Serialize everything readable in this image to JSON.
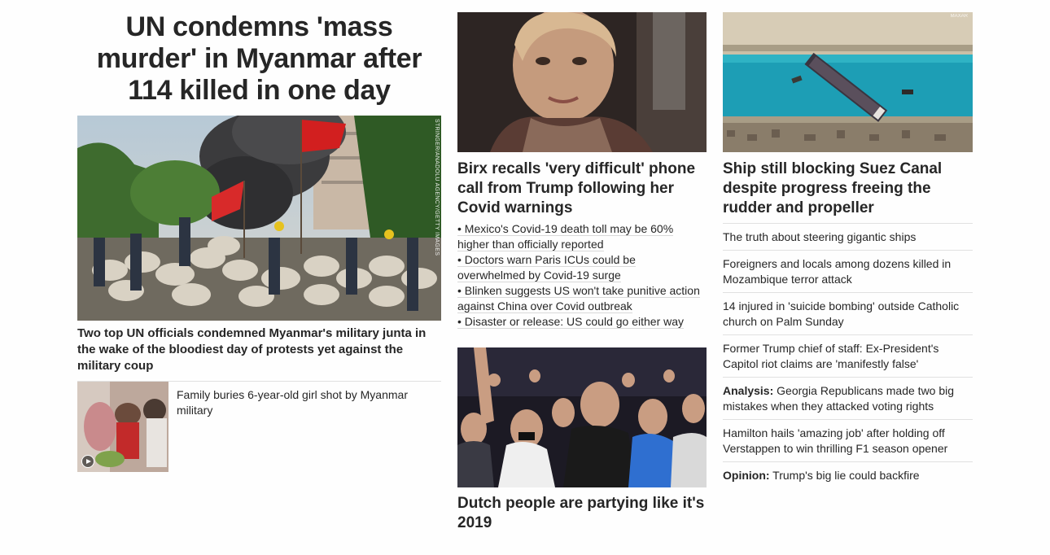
{
  "col1": {
    "headline": "UN condemns 'mass murder' in Myanmar after 114 killed in one day",
    "hero_credit": "STRINGER/ANADOLU AGENCY/GETTY IMAGES",
    "hero_caption": "Two top UN officials condemned Myanmar's military junta in the wake of the bloodiest day of protests yet against the military coup",
    "thumb_story": "Family buries 6-year-old girl shot by Myanmar military"
  },
  "col2": {
    "birx_headline": "Birx recalls 'very difficult' phone call from Trump following her Covid warnings",
    "bullets": [
      "• Mexico's Covid-19 death toll may be 60% higher than officially reported",
      "• Doctors warn Paris ICUs could be overwhelmed by Covid-19 surge",
      "• Blinken suggests US won't take punitive action against China over Covid outbreak",
      "• Disaster or release: US could go either way"
    ],
    "dutch_headline": "Dutch people are partying like it's 2019"
  },
  "col3": {
    "suez_headline": "Ship still blocking Suez Canal despite progress freeing the rudder and propeller",
    "watermark": "MAXAR",
    "links": [
      {
        "prefix": "",
        "text": "The truth about steering gigantic ships"
      },
      {
        "prefix": "",
        "text": "Foreigners and locals among dozens killed in Mozambique terror attack"
      },
      {
        "prefix": "",
        "text": "14 injured in 'suicide bombing' outside Catholic church on Palm Sunday"
      },
      {
        "prefix": "",
        "text": "Former Trump chief of staff: Ex-President's Capitol riot claims are 'manifestly false'"
      },
      {
        "prefix": "Analysis:",
        "text": " Georgia Republicans made two big mistakes when they attacked voting rights"
      },
      {
        "prefix": "",
        "text": "Hamilton hails 'amazing job' after holding off Verstappen to win thrilling F1 season opener"
      },
      {
        "prefix": "Opinion:",
        "text": " Trump's big lie could backfire"
      }
    ]
  },
  "colors": {
    "text": "#262626",
    "divider": "#e1e1e1"
  }
}
